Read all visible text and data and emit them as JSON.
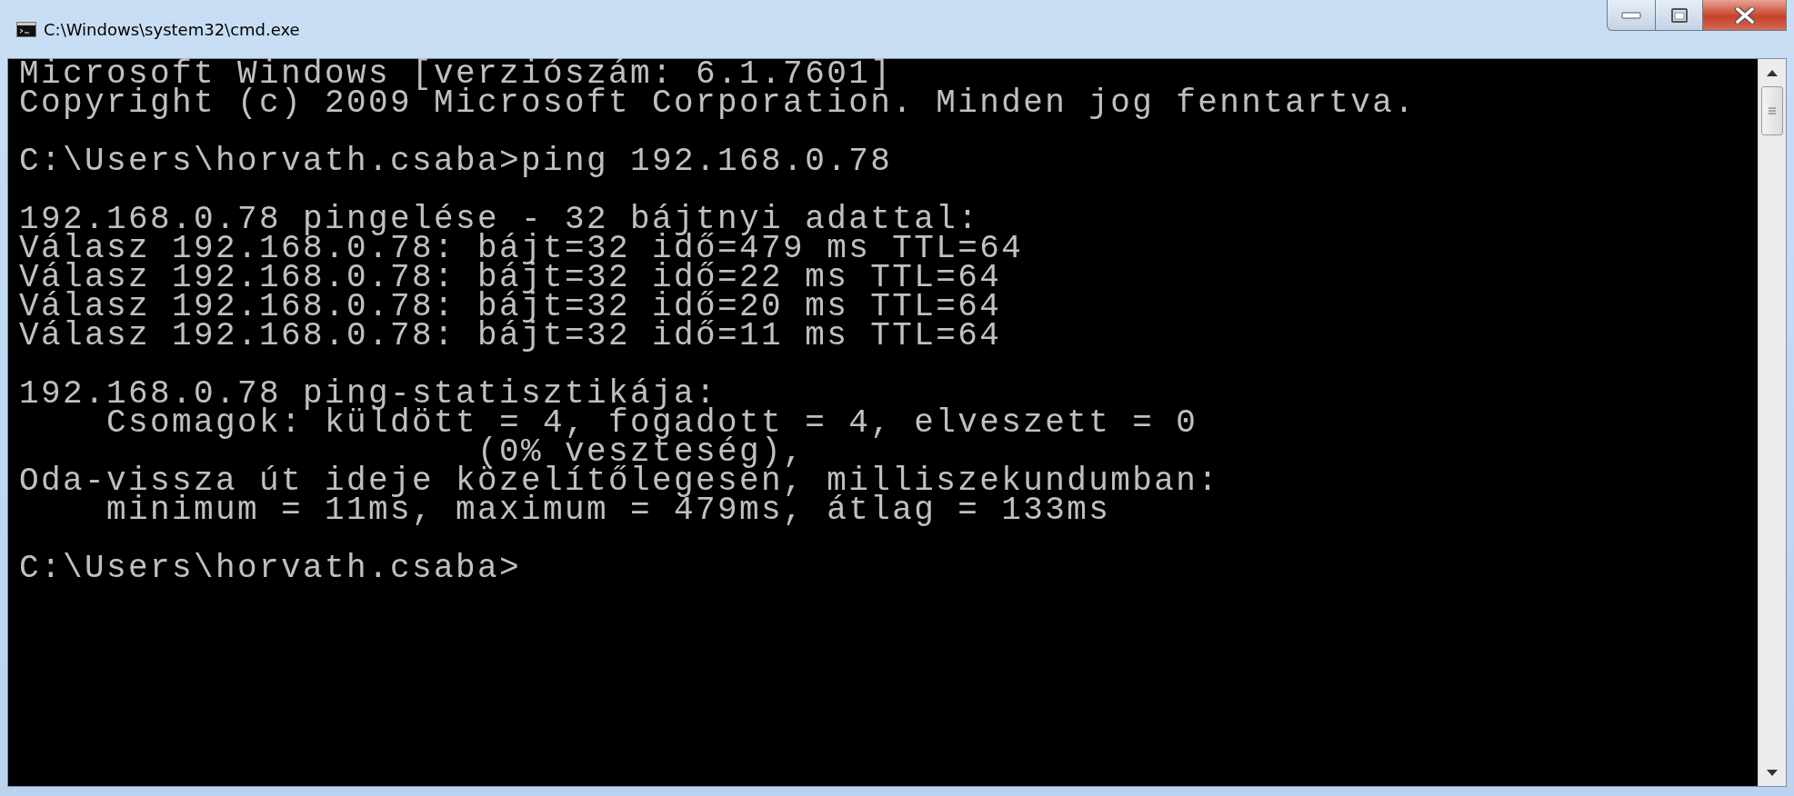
{
  "window": {
    "title": "C:\\Windows\\system32\\cmd.exe"
  },
  "console": {
    "blocks": [
      [
        "Microsoft Windows [verziószám: 6.1.7601]",
        "Copyright (c) 2009 Microsoft Corporation. Minden jog fenntartva."
      ],
      [
        "C:\\Users\\horvath.csaba>ping 192.168.0.78"
      ],
      [
        "192.168.0.78 pingelése - 32 bájtnyi adattal:",
        "Válasz 192.168.0.78: bájt=32 idő=479 ms TTL=64",
        "Válasz 192.168.0.78: bájt=32 idő=22 ms TTL=64",
        "Válasz 192.168.0.78: bájt=32 idő=20 ms TTL=64",
        "Válasz 192.168.0.78: bájt=32 idő=11 ms TTL=64"
      ],
      [
        "192.168.0.78 ping-statisztikája:",
        "    Csomagok: küldött = 4, fogadott = 4, elveszett = 0",
        "                     (0% veszteség),",
        "Oda-vissza út ideje közelítőlegesen, milliszekundumban:",
        "    minimum = 11ms, maximum = 479ms, átlag = 133ms"
      ],
      [
        "C:\\Users\\horvath.csaba>"
      ]
    ]
  }
}
